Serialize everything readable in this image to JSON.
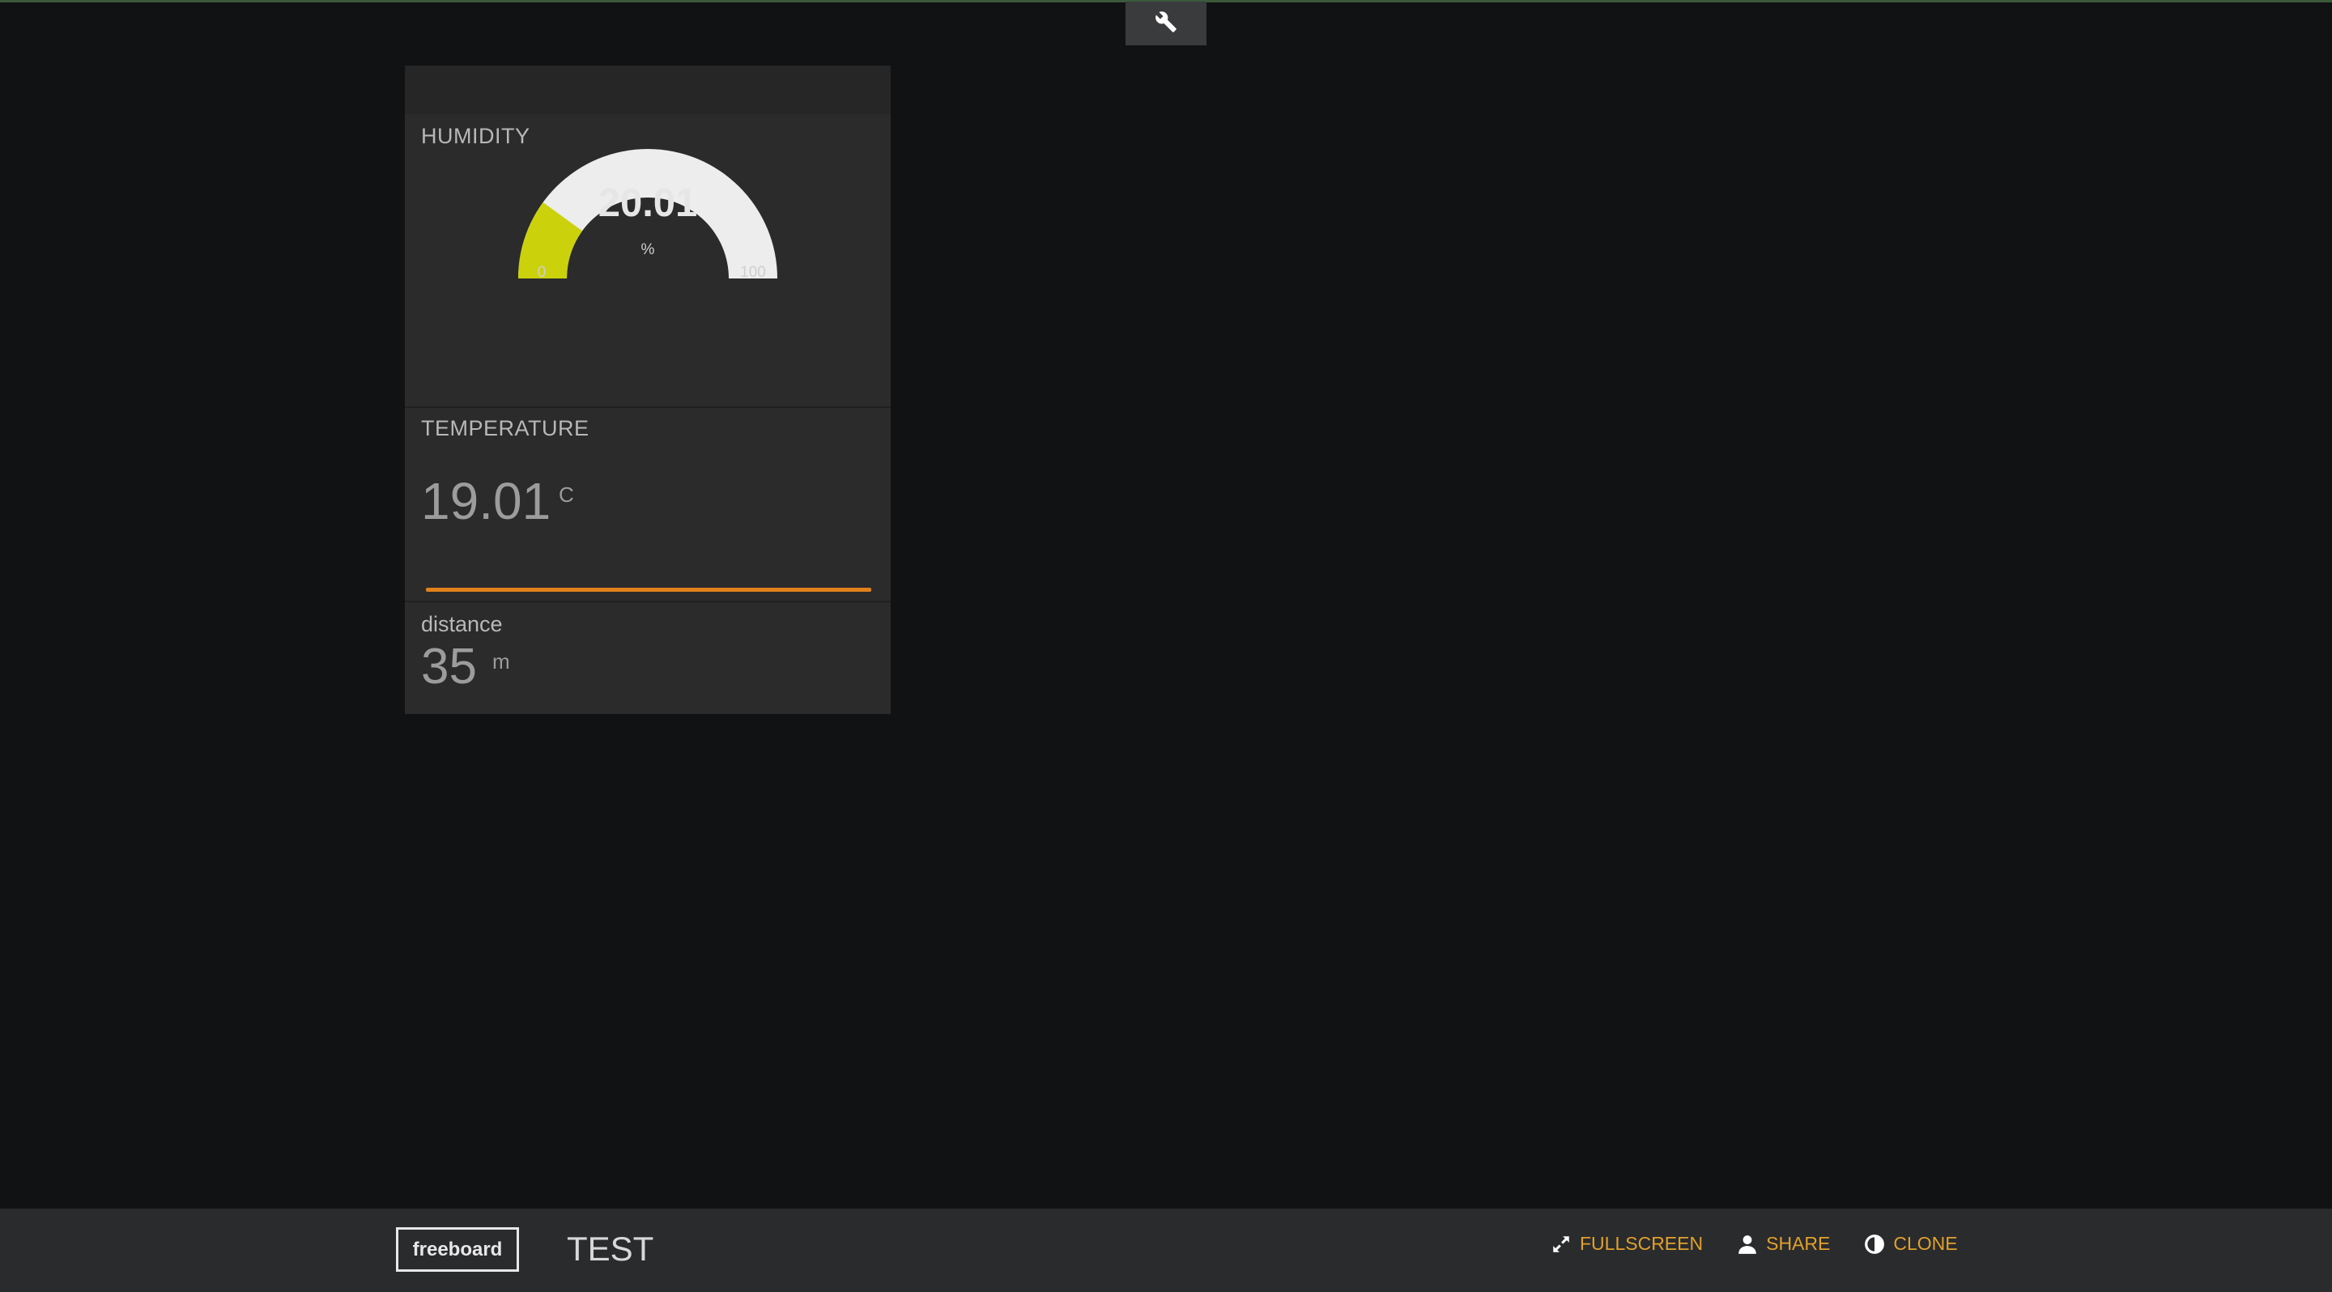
{
  "colors": {
    "background": "#101214",
    "pane": "#2b2b2b",
    "gauge_fill": "#cbd20c",
    "gauge_track": "#ededed",
    "sparkline": "#e1811b",
    "action_text": "#e1a12b"
  },
  "toolbar": {
    "settings_icon": "wrench-icon"
  },
  "widgets": {
    "humidity": {
      "title": "HUMIDITY",
      "value": "20.01",
      "units": "%",
      "min": "0",
      "max": "100",
      "fraction": 0.2001
    },
    "temperature": {
      "title": "TEMPERATURE",
      "value": "19.01",
      "units": "C"
    },
    "distance": {
      "title": "distance",
      "value": "35",
      "units": "m"
    }
  },
  "footer": {
    "logo": "freeboard",
    "board_title": "TEST",
    "actions": [
      {
        "label": "FULLSCREEN",
        "icon": "expand-icon"
      },
      {
        "label": "SHARE",
        "icon": "user-icon"
      },
      {
        "label": "CLONE",
        "icon": "contrast-icon"
      }
    ]
  }
}
